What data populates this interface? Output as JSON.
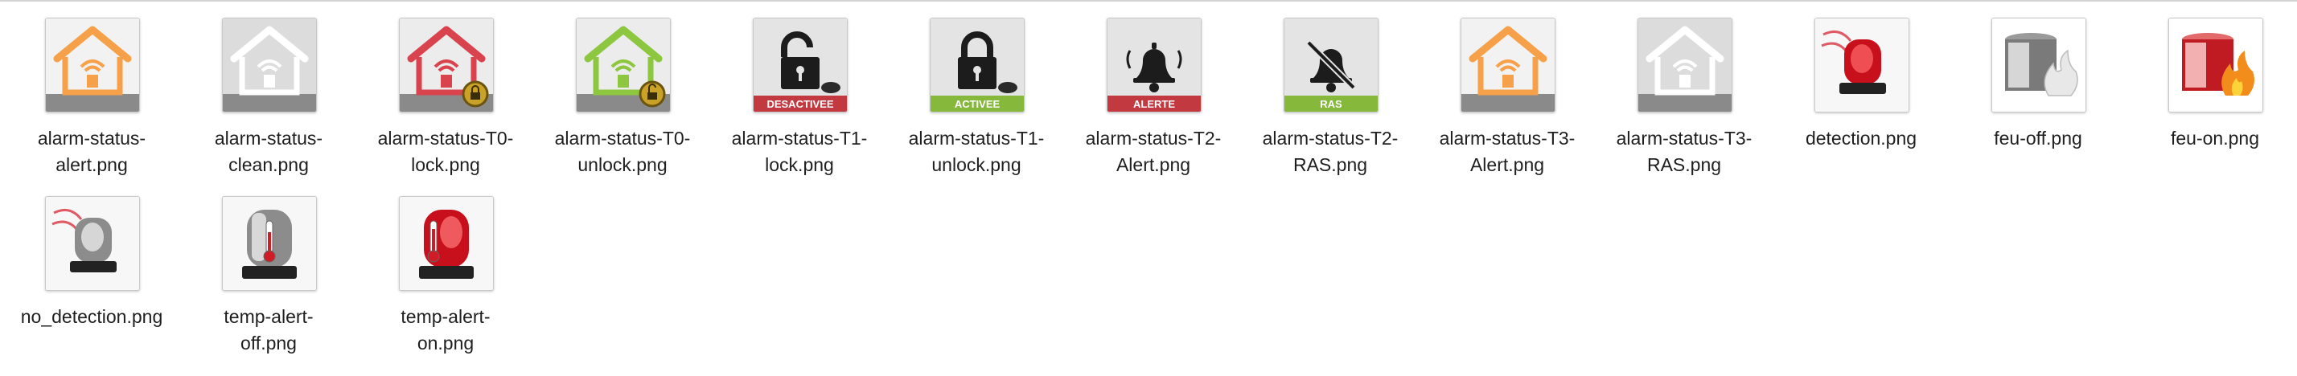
{
  "files": [
    {
      "lines": [
        "alarm-status-",
        "alert.png"
      ],
      "icon": "house-alert-orange-icon"
    },
    {
      "lines": [
        "alarm-status-",
        "clean.png"
      ],
      "icon": "house-clean-white-icon"
    },
    {
      "lines": [
        "alarm-status-T0-",
        "lock.png"
      ],
      "icon": "house-red-lock-icon"
    },
    {
      "lines": [
        "alarm-status-T0-",
        "unlock.png"
      ],
      "icon": "house-green-unlock-icon"
    },
    {
      "lines": [
        "alarm-status-T1-",
        "lock.png"
      ],
      "icon": "padlock-open-icon",
      "badge": "DESACTIVEE"
    },
    {
      "lines": [
        "alarm-status-T1-",
        "unlock.png"
      ],
      "icon": "padlock-closed-icon",
      "badge": "ACTIVEE"
    },
    {
      "lines": [
        "alarm-status-T2-",
        "Alert.png"
      ],
      "icon": "bell-icon",
      "badge": "ALERTE"
    },
    {
      "lines": [
        "alarm-status-T2-",
        "RAS.png"
      ],
      "icon": "bell-muted-icon",
      "badge": "RAS"
    },
    {
      "lines": [
        "alarm-status-T3-",
        "Alert.png"
      ],
      "icon": "house-alert-orange-icon"
    },
    {
      "lines": [
        "alarm-status-T3-",
        "RAS.png"
      ],
      "icon": "house-clean-white-icon"
    },
    {
      "lines": [
        "detection.png"
      ],
      "icon": "siren-red-detection-icon"
    },
    {
      "lines": [
        "feu-off.png"
      ],
      "icon": "fire-off-icon"
    },
    {
      "lines": [
        "feu-on.png"
      ],
      "icon": "fire-on-icon"
    },
    {
      "lines": [
        "no_detection.png"
      ],
      "icon": "siren-off-detection-icon"
    },
    {
      "lines": [
        "temp-alert-",
        "off.png"
      ],
      "icon": "thermometer-siren-off-icon"
    },
    {
      "lines": [
        "temp-alert-",
        "on.png"
      ],
      "icon": "thermometer-siren-on-icon"
    }
  ],
  "colors": {
    "orange": "#f6a04a",
    "red": "#d9434d",
    "green": "#8dc63f",
    "gray_band": "#8a8a8a"
  }
}
